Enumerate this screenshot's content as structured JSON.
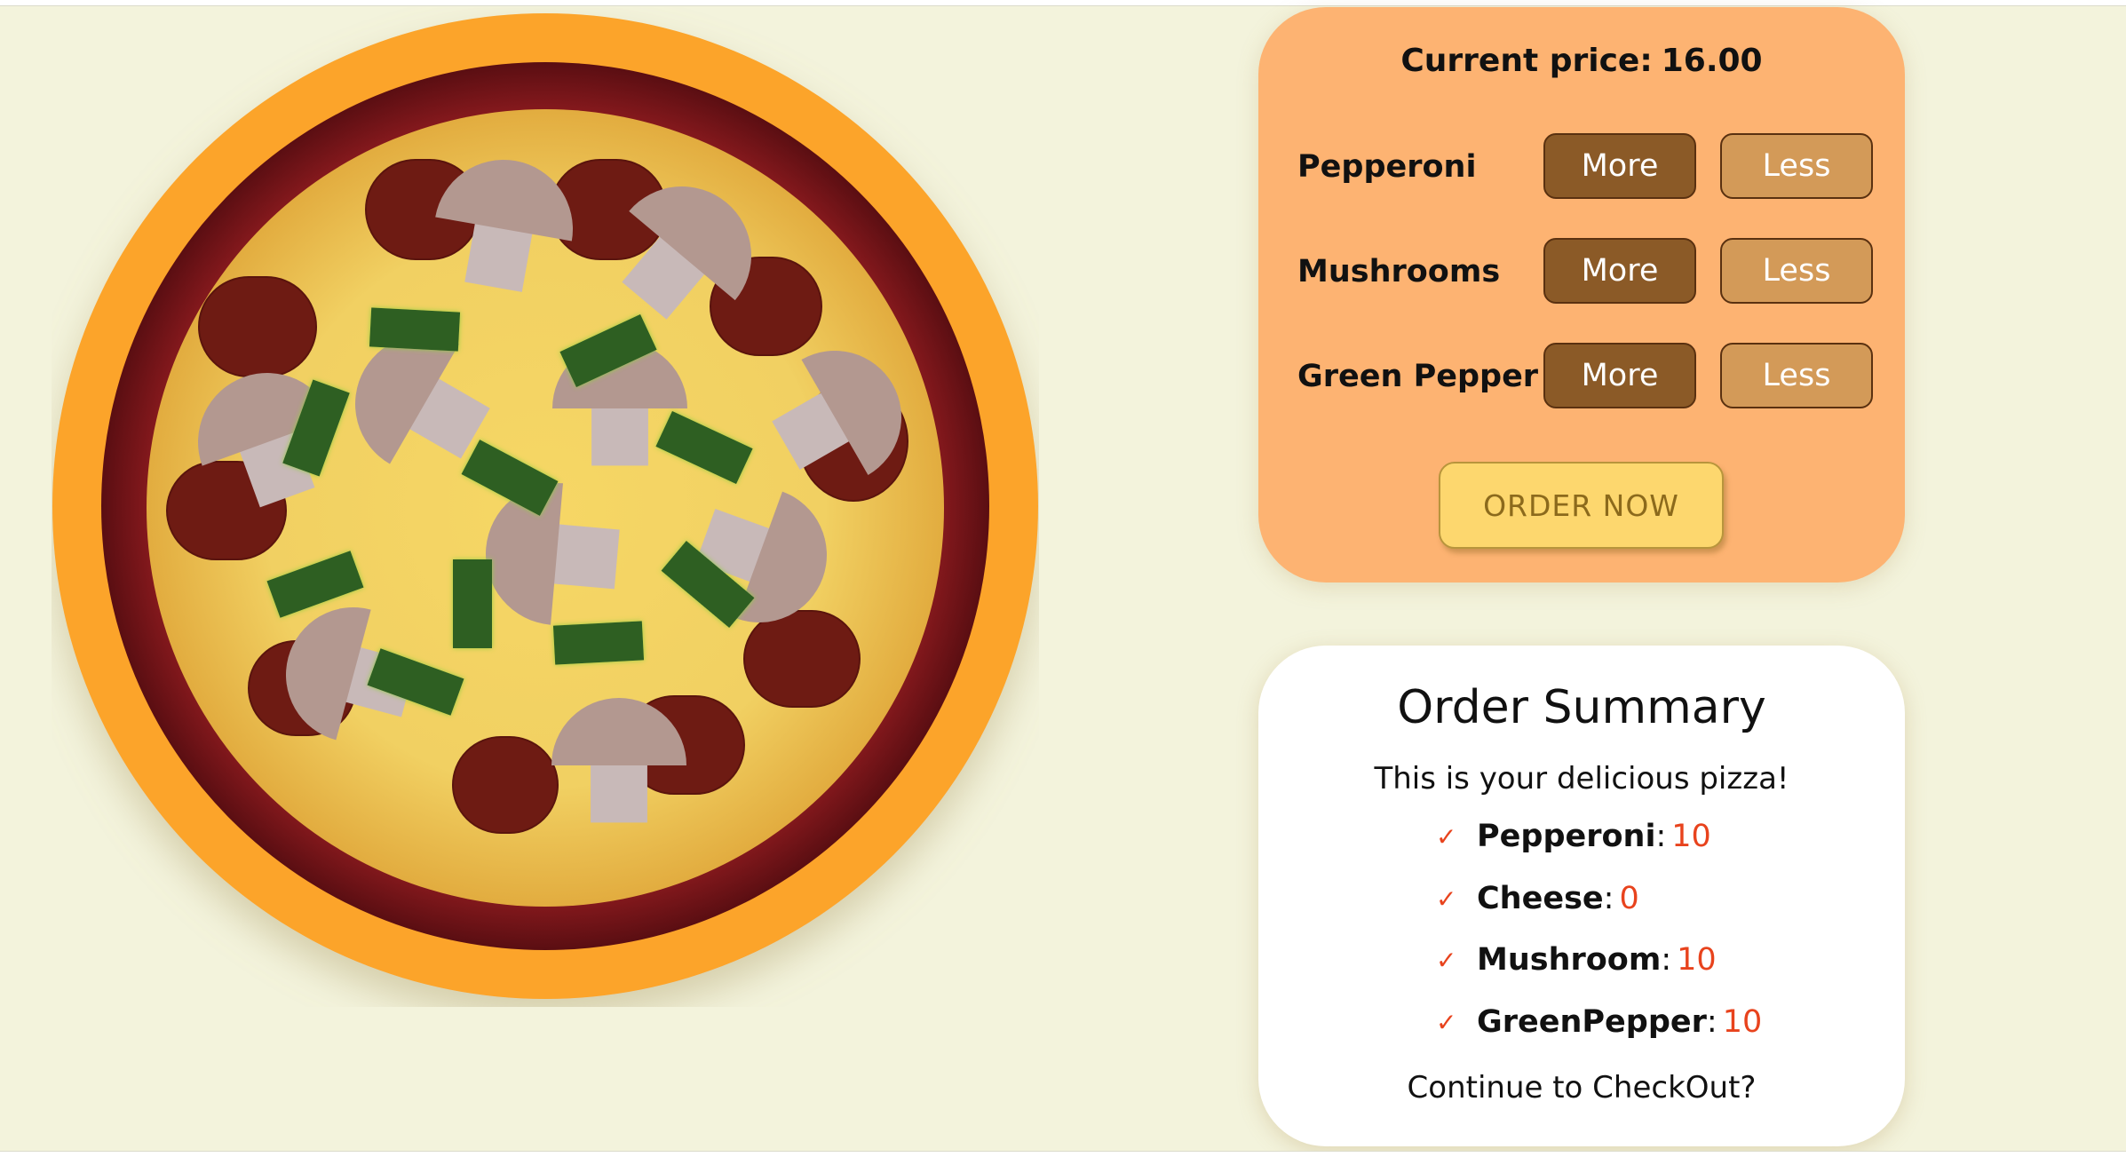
{
  "colors": {
    "background": "#f3f3dc",
    "panel": "#fdb372",
    "more_button": "#8b5a27",
    "less_button": "#d39a58",
    "order_button": "#fdd76e",
    "accent": "#e8431d"
  },
  "pizza": {
    "toppings": [
      "pepperoni",
      "mushroom",
      "green-pepper"
    ]
  },
  "controls": {
    "price_label": "Current price:",
    "price_value": "16.00",
    "rows": [
      {
        "label": "Pepperoni",
        "more": "More",
        "less": "Less"
      },
      {
        "label": "Mushrooms",
        "more": "More",
        "less": "Less"
      },
      {
        "label": "Green Pepper",
        "more": "More",
        "less": "Less"
      }
    ],
    "order_button": "ORDER NOW"
  },
  "summary": {
    "title": "Order Summary",
    "subtitle": "This is your delicious pizza!",
    "items": [
      {
        "name": "Pepperoni",
        "value": "10"
      },
      {
        "name": "Cheese",
        "value": "0"
      },
      {
        "name": "Mushroom",
        "value": "10"
      },
      {
        "name": "GreenPepper",
        "value": "10"
      }
    ],
    "footer": "Continue to CheckOut?"
  }
}
